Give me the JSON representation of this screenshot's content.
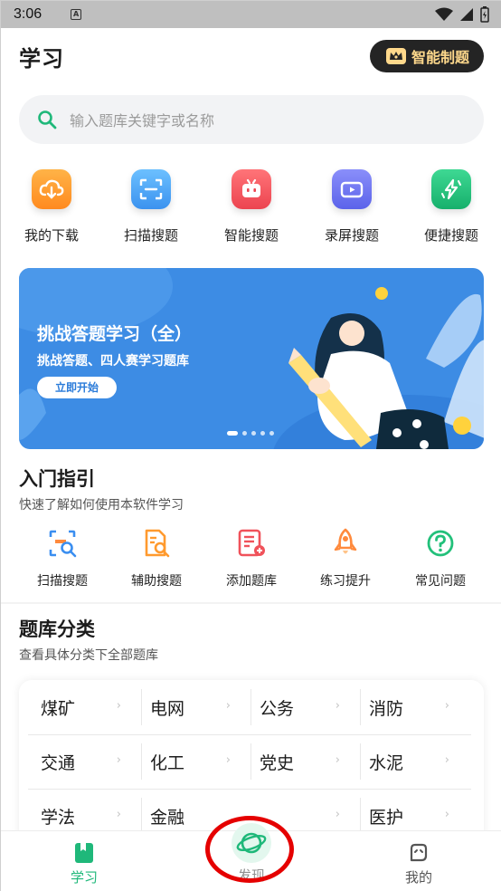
{
  "status_bar": {
    "time": "3:06",
    "notification_letter": "A"
  },
  "header": {
    "title": "学习",
    "vip_button": "智能制题"
  },
  "search": {
    "placeholder": "输入题库关键字或名称"
  },
  "tools": [
    {
      "label": "我的下载",
      "icon": "cloud-download-icon",
      "color": "#ff9a2e"
    },
    {
      "label": "扫描搜题",
      "icon": "scan-frame-icon",
      "color": "#4aa6f2"
    },
    {
      "label": "智能搜题",
      "icon": "tv-robot-icon",
      "color": "#f0525a"
    },
    {
      "label": "录屏搜题",
      "icon": "video-camera-icon",
      "color": "#6a73f0"
    },
    {
      "label": "便捷搜题",
      "icon": "lightning-icon",
      "color": "#22c07a"
    }
  ],
  "banner": {
    "title": "挑战答题学习（全）",
    "subtitle": "挑战答题、四人赛学习题库",
    "button": "立即开始"
  },
  "guide": {
    "title": "入门指引",
    "subtitle": "快速了解如何使用本软件学习",
    "items": [
      {
        "label": "扫描搜题",
        "icon": "scan-search-icon"
      },
      {
        "label": "辅助搜题",
        "icon": "document-search-icon"
      },
      {
        "label": "添加题库",
        "icon": "add-list-icon"
      },
      {
        "label": "练习提升",
        "icon": "rocket-icon"
      },
      {
        "label": "常见问题",
        "icon": "question-circle-icon"
      }
    ]
  },
  "categories": {
    "title": "题库分类",
    "subtitle": "查看具体分类下全部题库",
    "items": [
      "煤矿",
      "电网",
      "公务",
      "消防",
      "交通",
      "化工",
      "党史",
      "水泥",
      "学法",
      "金融",
      "税务",
      "医护"
    ],
    "arrow": "›"
  },
  "bottom_nav": {
    "items": [
      {
        "label": "学习",
        "icon": "book-icon",
        "active": true
      },
      {
        "label": "发现",
        "icon": "planet-icon",
        "active": false
      },
      {
        "label": "我的",
        "icon": "profile-face-icon",
        "active": false
      }
    ]
  },
  "colors": {
    "accent_green": "#1fb87a",
    "banner_blue": "#3d8ce4",
    "highlight_red": "#e50000"
  }
}
